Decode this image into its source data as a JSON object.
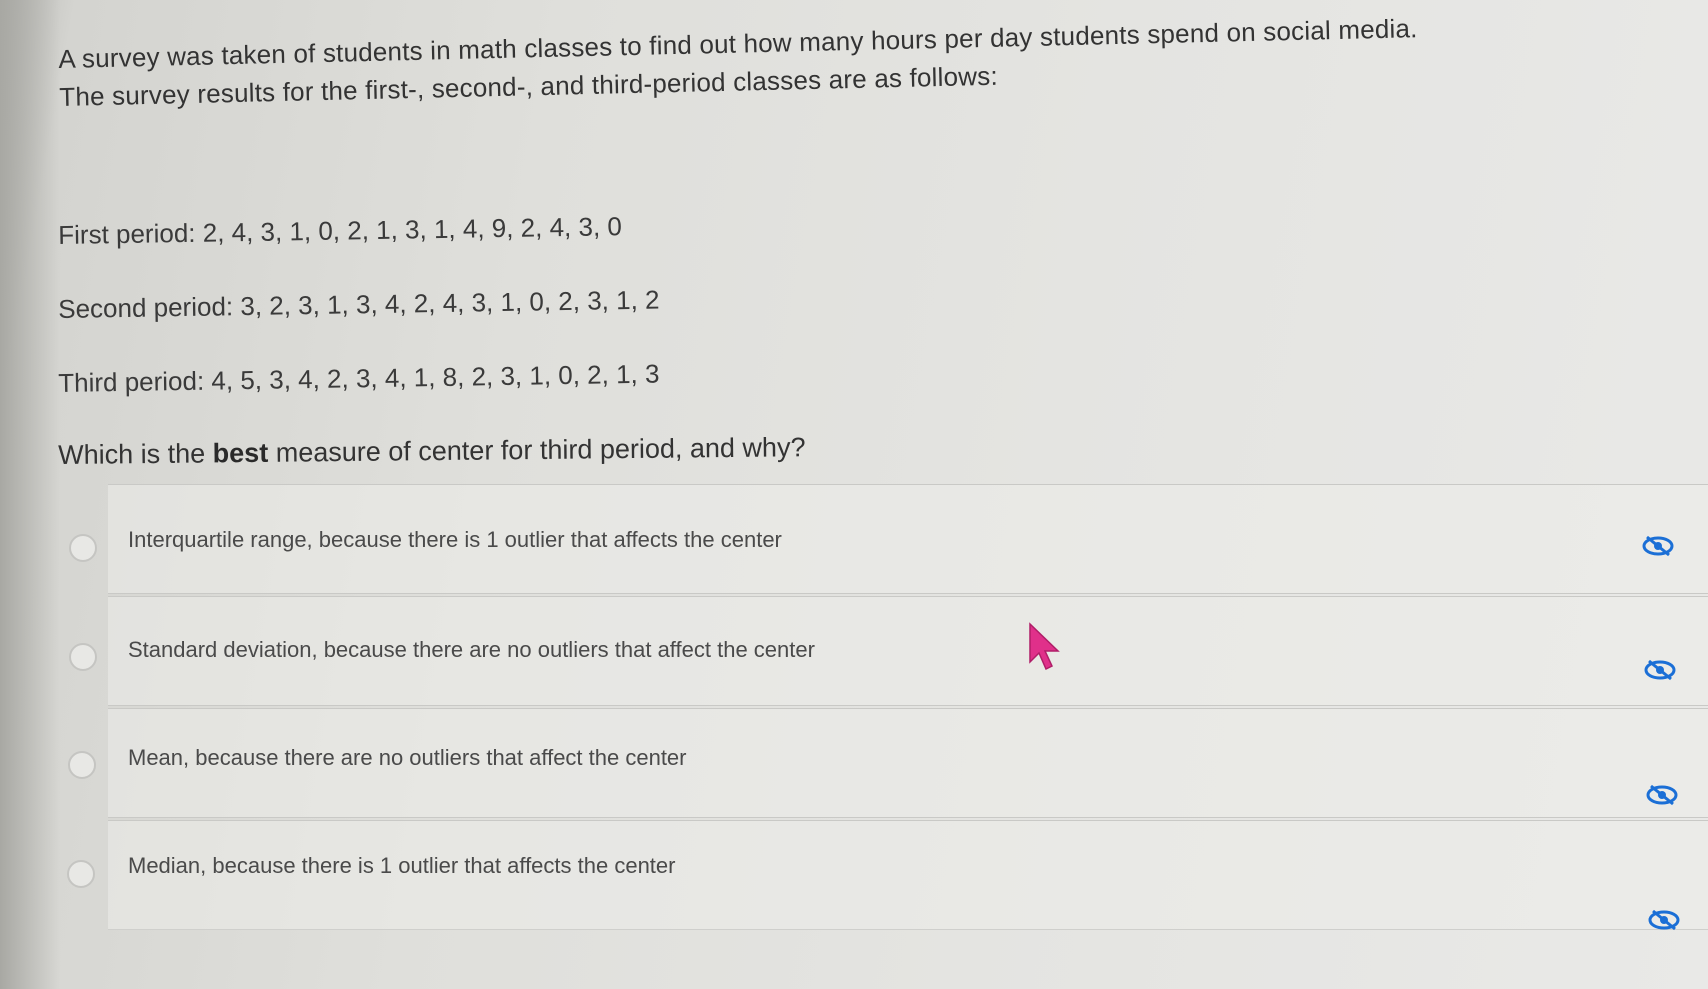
{
  "intro": {
    "line1": "A survey was taken of students in math classes to find out how many hours per day students spend on social media.",
    "line2": "The survey results for the first-, second-, and third-period classes are as follows:"
  },
  "periods": [
    {
      "label": "First period:",
      "values": "2, 4, 3, 1, 0, 2, 1, 3, 1, 4, 9, 2, 4, 3, 0"
    },
    {
      "label": "Second period:",
      "values": "3, 2, 3, 1, 3, 4, 2, 4, 3, 1, 0, 2, 3, 1, 2"
    },
    {
      "label": "Third period:",
      "values": "4, 5, 3, 4, 2, 3, 4, 1, 8, 2, 3, 1, 0, 2, 1, 3"
    }
  ],
  "question": {
    "prefix": "Which is the ",
    "emphasis": "best",
    "suffix": " measure of center for third period, and why?"
  },
  "options": [
    {
      "text": "Interquartile range, because there is 1 outlier that affects the center",
      "selected": false,
      "eliminate_icon": "eye-slash-icon"
    },
    {
      "text": "Standard deviation, because there are no outliers that affect the center",
      "selected": false,
      "eliminate_icon": "eye-slash-icon"
    },
    {
      "text": "Mean, because there are no outliers that affect the center",
      "selected": false,
      "eliminate_icon": "eye-slash-icon"
    },
    {
      "text": "Median, because there is 1 outlier that affects the center",
      "selected": false,
      "eliminate_icon": "eye-slash-icon"
    }
  ],
  "colors": {
    "eliminate_icon": "#1b6fd6",
    "cursor": "#e0308a"
  }
}
